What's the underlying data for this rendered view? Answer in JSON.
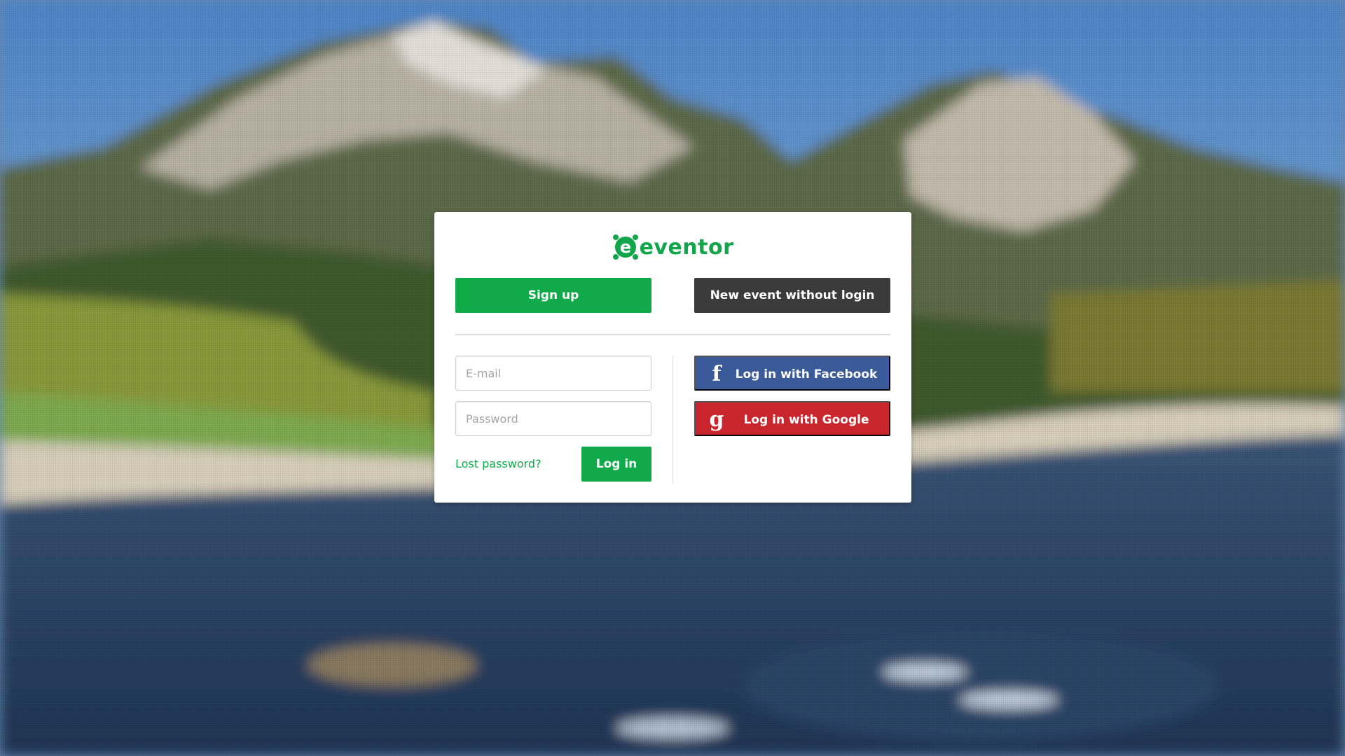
{
  "brand": {
    "name": "eventor",
    "color": "#12a64a"
  },
  "actions": {
    "signup_label": "Sign up",
    "new_event_label": "New event without login"
  },
  "login_form": {
    "email_placeholder": "E-mail",
    "password_placeholder": "Password",
    "lost_password_label": "Lost password?",
    "login_label": "Log in"
  },
  "social": {
    "facebook": {
      "icon": "facebook-icon",
      "icon_glyph": "f",
      "label": "Log in with Facebook",
      "color": "#3b5a9a"
    },
    "google": {
      "icon": "google-icon",
      "icon_glyph": "g",
      "label": "Log in with Google",
      "color": "#c9252c"
    }
  },
  "colors": {
    "accent": "#11aa4b",
    "dark_button": "#3b3b3b"
  }
}
